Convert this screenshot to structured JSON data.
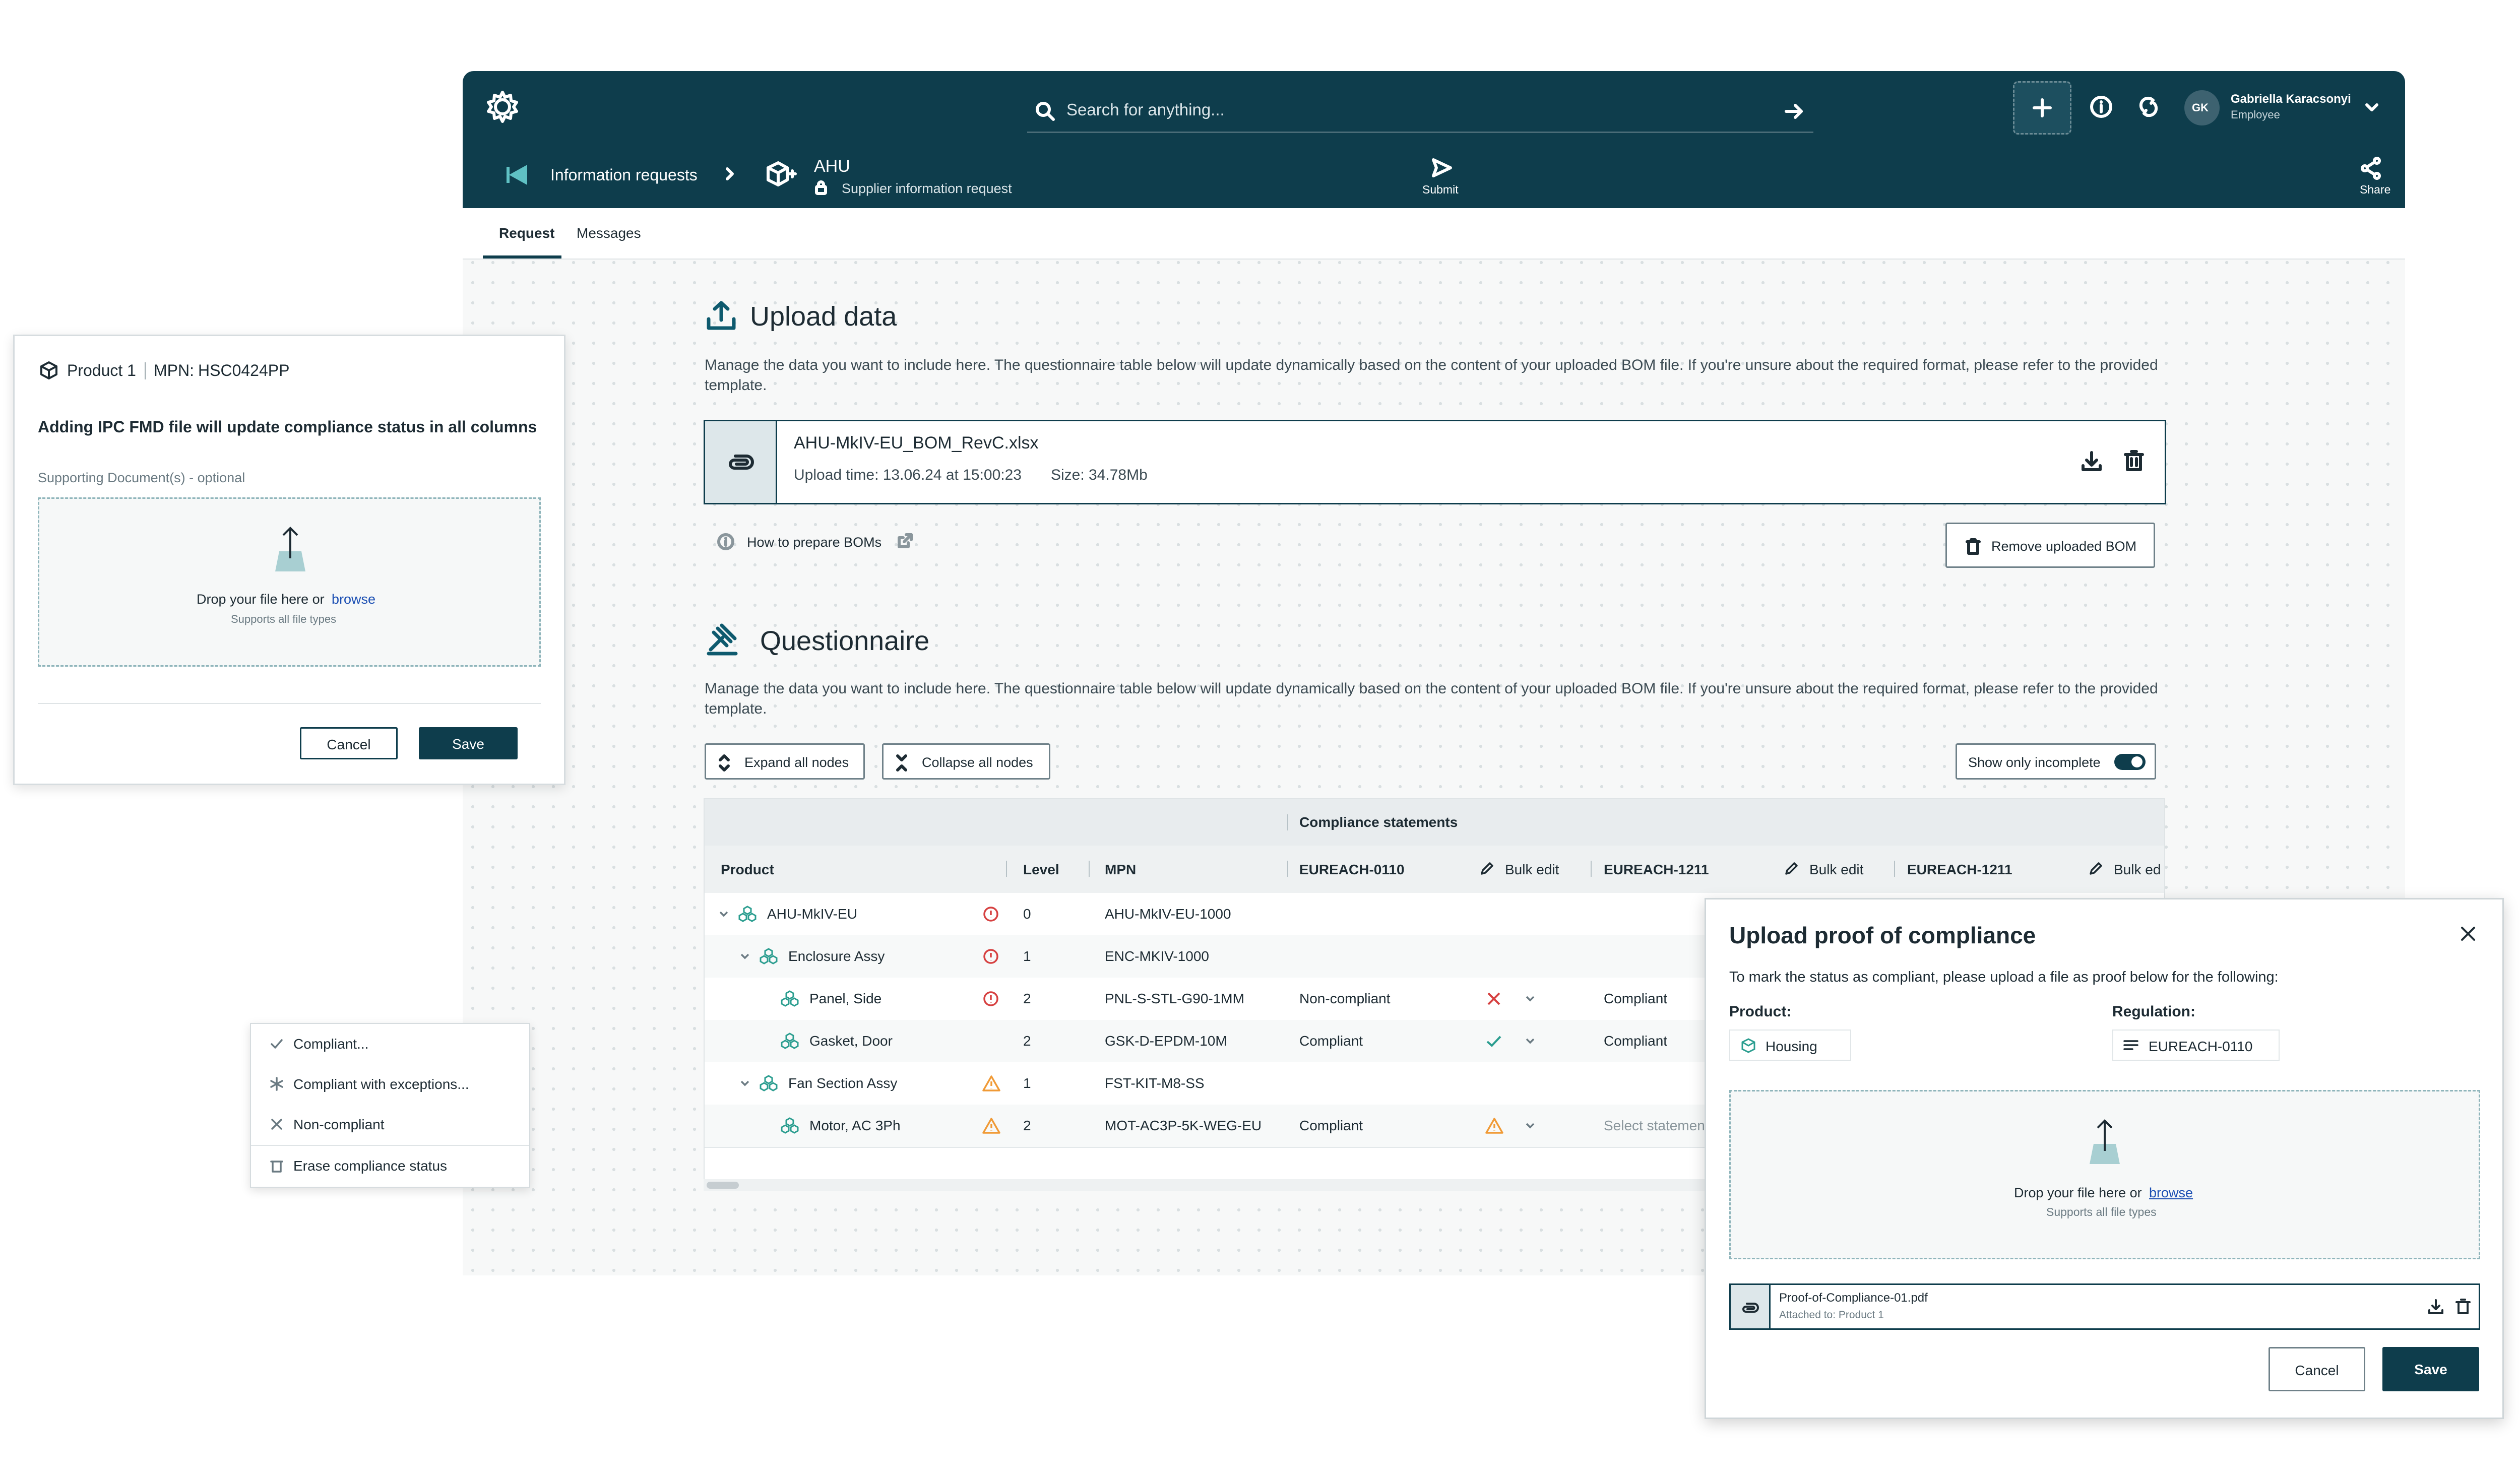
{
  "app": {
    "search_placeholder": "Search for anything...",
    "user": {
      "initials": "GK",
      "name": "Gabriella Karacsonyi",
      "role": "Employee"
    },
    "breadcrumb": {
      "parent": "Information requests",
      "title": "AHU",
      "subtitle": "Supplier information request"
    },
    "actions": {
      "submit": "Submit",
      "share": "Share"
    },
    "tabs": [
      {
        "label": "Request",
        "active": true
      },
      {
        "label": "Messages",
        "active": false
      }
    ]
  },
  "upload": {
    "title": "Upload data",
    "description": "Manage the data you want to include here. The questionnaire table below will update dynamically based on the content of your uploaded BOM file. If you're unsure about the required format, please refer to the provided template.",
    "file": {
      "name": "AHU-MkIV-EU_BOM_RevC.xlsx",
      "upload_time": "Upload time: 13.06.24 at 15:00:23",
      "size": "Size: 34.78Mb"
    },
    "help_link": "How to prepare BOMs",
    "remove_button": "Remove uploaded BOM"
  },
  "questionnaire": {
    "title": "Questionnaire",
    "description": "Manage the data you want to include here. The questionnaire table below will update dynamically based on the content of your uploaded BOM file. If you're unsure about the required format, please refer to the provided template.",
    "expand": "Expand all nodes",
    "collapse": "Collapse all nodes",
    "toggle_label": "Show only incomplete",
    "group_header": "Compliance statements",
    "columns": {
      "product": "Product",
      "level": "Level",
      "mpn": "MPN",
      "reg1": "EUREACH-0110",
      "reg2": "EUREACH-1211",
      "reg3": "EUREACH-1211",
      "bulk": "Bulk edit",
      "bulk_cut": "Bulk ed"
    },
    "rows": [
      {
        "product": "AHU-MkIV-EU",
        "level": "0",
        "mpn": "AHU-MkIV-EU-1000",
        "s1": "",
        "s2": "",
        "status_icon": "error-icon",
        "indent": 0,
        "expander": true,
        "s1_icon": ""
      },
      {
        "product": "Enclosure Assy",
        "level": "1",
        "mpn": "ENC-MKIV-1000",
        "s1": "",
        "s2": "",
        "status_icon": "error-icon",
        "indent": 1,
        "expander": true,
        "s1_icon": ""
      },
      {
        "product": "Panel, Side",
        "level": "2",
        "mpn": "PNL-S-STL-G90-1MM",
        "s1": "Non-compliant",
        "s2": "Compliant",
        "status_icon": "error-icon",
        "indent": 2,
        "expander": false,
        "s1_icon": "cross-icon"
      },
      {
        "product": "Gasket, Door",
        "level": "2",
        "mpn": "GSK-D-EPDM-10M",
        "s1": "Compliant",
        "s2": "Compliant",
        "status_icon": "",
        "indent": 2,
        "expander": false,
        "s1_icon": "check-icon"
      },
      {
        "product": "Fan Section Assy",
        "level": "1",
        "mpn": "FST-KIT-M8-SS",
        "s1": "",
        "s2": "",
        "status_icon": "warning-icon",
        "indent": 1,
        "expander": true,
        "s1_icon": ""
      },
      {
        "product": "Motor, AC 3Ph",
        "level": "2",
        "mpn": "MOT-AC3P-5K-WEG-EU",
        "s1": "Compliant",
        "s2": "Select statemen",
        "status_icon": "warning-icon",
        "indent": 2,
        "expander": false,
        "s1_icon": "warning-icon"
      }
    ]
  },
  "left_modal": {
    "product_label": "Product 1",
    "mpn_label": "MPN:",
    "mpn_value": "HSC0424PP",
    "heading": "Adding IPC FMD file will update compliance status in all columns",
    "docs_label": "Supporting Document(s) - optional",
    "drop_text": "Drop your file here or",
    "browse": "browse",
    "supports": "Supports all file types",
    "cancel": "Cancel",
    "save": "Save"
  },
  "status_menu": {
    "items": [
      {
        "label": "Compliant...",
        "icon": "check-icon"
      },
      {
        "label": "Compliant with exceptions...",
        "icon": "asterisk-icon"
      },
      {
        "label": "Non-compliant",
        "icon": "cross-icon"
      },
      {
        "label": "Erase compliance status",
        "icon": "trash-icon"
      }
    ]
  },
  "right_modal": {
    "title": "Upload proof of compliance",
    "description": "To mark the status as compliant, please upload a file as proof below for the following:",
    "product_label": "Product:",
    "product_value": "Housing",
    "regulation_label": "Regulation:",
    "regulation_value": "EUREACH-0110",
    "drop_text": "Drop your file here or",
    "browse": "browse",
    "supports": "Supports all file types",
    "file_name": "Proof-of-Compliance-01.pdf",
    "file_attached": "Attached to: Product 1",
    "cancel": "Cancel",
    "save": "Save"
  },
  "colors": {
    "brand": "#0e3d4c",
    "error": "#d64040",
    "warning": "#f09a36",
    "success": "#2a9d8f"
  }
}
